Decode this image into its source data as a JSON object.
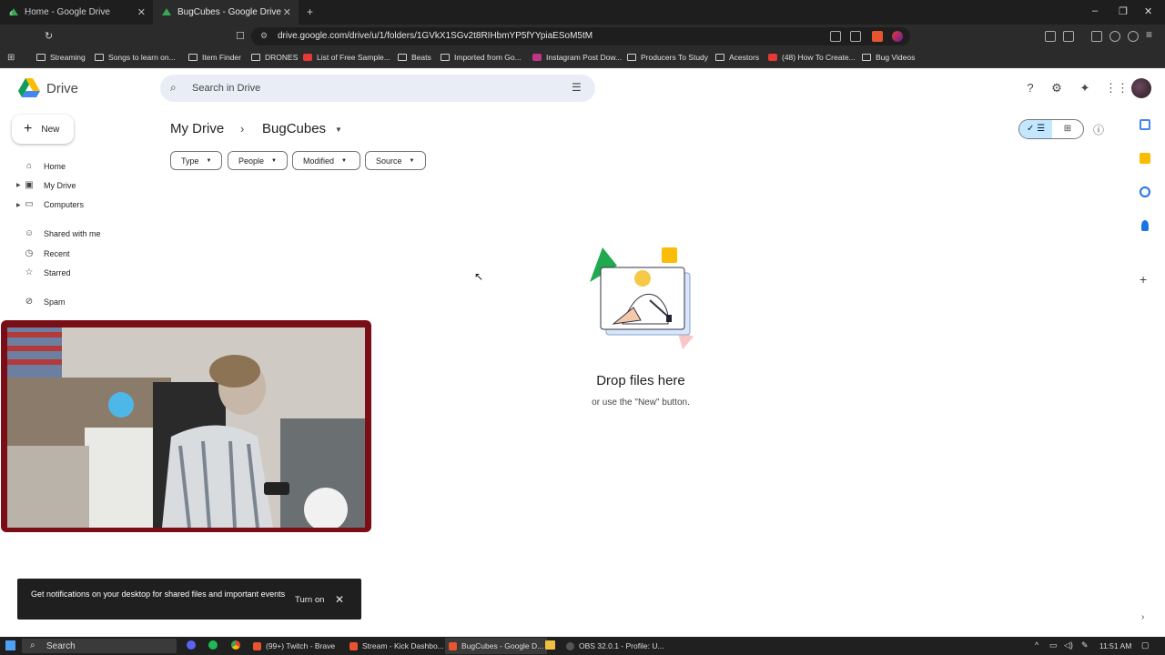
{
  "browser": {
    "tabs": [
      {
        "label": "Home - Google Drive",
        "active": false
      },
      {
        "label": "BugCubes - Google Drive",
        "active": true
      }
    ],
    "new_tab": "+",
    "url": "drive.google.com/drive/u/1/folders/1GVkX1SGv2t8RIHbmYP5fYYpiaESoM5tM",
    "bookmarks": [
      {
        "label": "Streaming",
        "icon": "folder"
      },
      {
        "label": "Songs to learn on...",
        "icon": "folder"
      },
      {
        "label": "Item Finder",
        "icon": "folder"
      },
      {
        "label": "DRONES",
        "icon": "folder"
      },
      {
        "label": "List of Free Sample...",
        "icon": "site"
      },
      {
        "label": "Beats",
        "icon": "folder"
      },
      {
        "label": "Imported from Go...",
        "icon": "folder"
      },
      {
        "label": "Instagram Post Dow...",
        "icon": "site"
      },
      {
        "label": "Producers To Study",
        "icon": "folder"
      },
      {
        "label": "Acestors",
        "icon": "folder"
      },
      {
        "label": "(48) How To Create...",
        "icon": "youtube"
      },
      {
        "label": "Bug Videos",
        "icon": "folder"
      }
    ]
  },
  "drive": {
    "brand": "Drive",
    "search_placeholder": "Search in Drive",
    "new_label": "New",
    "sidebar": [
      {
        "label": "Home",
        "icon": "home-icon"
      },
      {
        "label": "My Drive",
        "icon": "my-drive-icon"
      },
      {
        "label": "Computers",
        "icon": "computer-icon"
      },
      {
        "label": "Shared with me",
        "icon": "people-icon"
      },
      {
        "label": "Recent",
        "icon": "clock-icon"
      },
      {
        "label": "Starred",
        "icon": "star-icon"
      },
      {
        "label": "Spam",
        "icon": "spam-icon"
      }
    ],
    "breadcrumb": {
      "root": "My Drive",
      "current": "BugCubes"
    },
    "filters": [
      "Type",
      "People",
      "Modified",
      "Source"
    ],
    "empty": {
      "title": "Drop files here",
      "subtitle": "or use the \"New\" button."
    },
    "snackbar": {
      "text": "Get notifications on your desktop for shared files and important events",
      "action": "Turn on"
    },
    "colors": {
      "accent": "#c2e7ff",
      "snackbar": "#1f1f1f",
      "cam_border": "#7a0e16"
    }
  },
  "taskbar": {
    "search": "Search",
    "apps": [
      {
        "label": "(99+) Twitch - Brave",
        "active": false
      },
      {
        "label": "Stream - Kick Dashbo...",
        "active": false
      },
      {
        "label": "BugCubes - Google D...",
        "active": true
      },
      {
        "label": "OBS 32.0.1 - Profile: U...",
        "active": false
      }
    ],
    "time": "11:51 AM"
  }
}
